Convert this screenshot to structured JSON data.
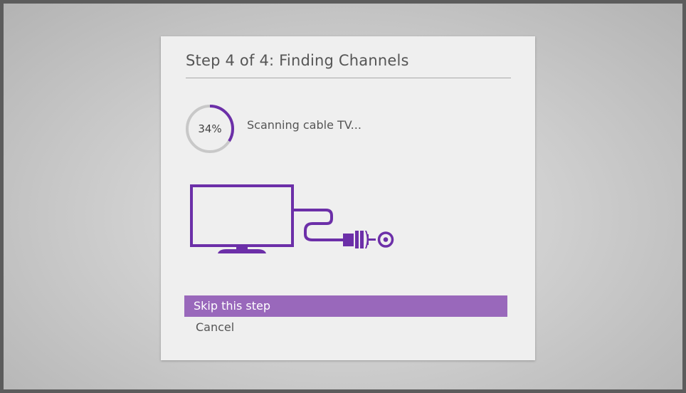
{
  "dialog": {
    "title": "Step 4 of 4: Finding Channels",
    "accent_color": "#6c2fa8",
    "selected_color": "#9968bb"
  },
  "scan": {
    "progress_label": "34%",
    "progress_fraction": 0.34,
    "status": "Scanning cable TV..."
  },
  "illustration": {
    "icon": "tv-cable-connection-icon"
  },
  "menu": {
    "items": [
      {
        "label": "Skip this step",
        "selected": true
      },
      {
        "label": "Cancel",
        "selected": false
      }
    ]
  }
}
